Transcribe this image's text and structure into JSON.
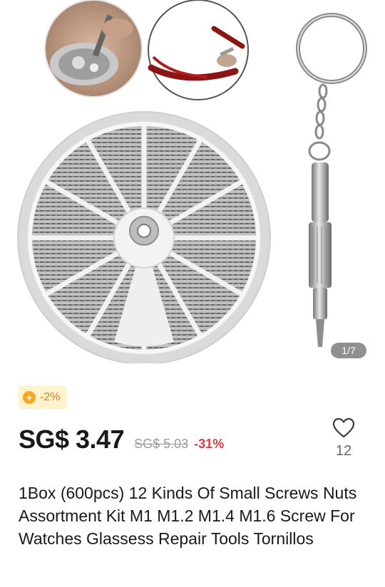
{
  "gallery": {
    "page_indicator": "1/7",
    "image_alt": "Screw assortment box with keychain screwdriver"
  },
  "coupon": {
    "icon": "coupon-plus-icon",
    "text": "-2%",
    "bg_color": "#fff3cc",
    "text_color": "#e0761a"
  },
  "price": {
    "current": "SG$ 3.47",
    "original": "SG$ 5.03",
    "discount": "-31%",
    "discount_color": "#e4393c"
  },
  "wishlist": {
    "icon": "heart-outline-icon",
    "count": "12"
  },
  "product": {
    "title": "1Box (600pcs) 12 Kinds Of Small Screws Nuts Assortment Kit M1 M1.2 M1.4 M1.6 Screw For Watches Glassess Repair Tools Tornillos"
  }
}
